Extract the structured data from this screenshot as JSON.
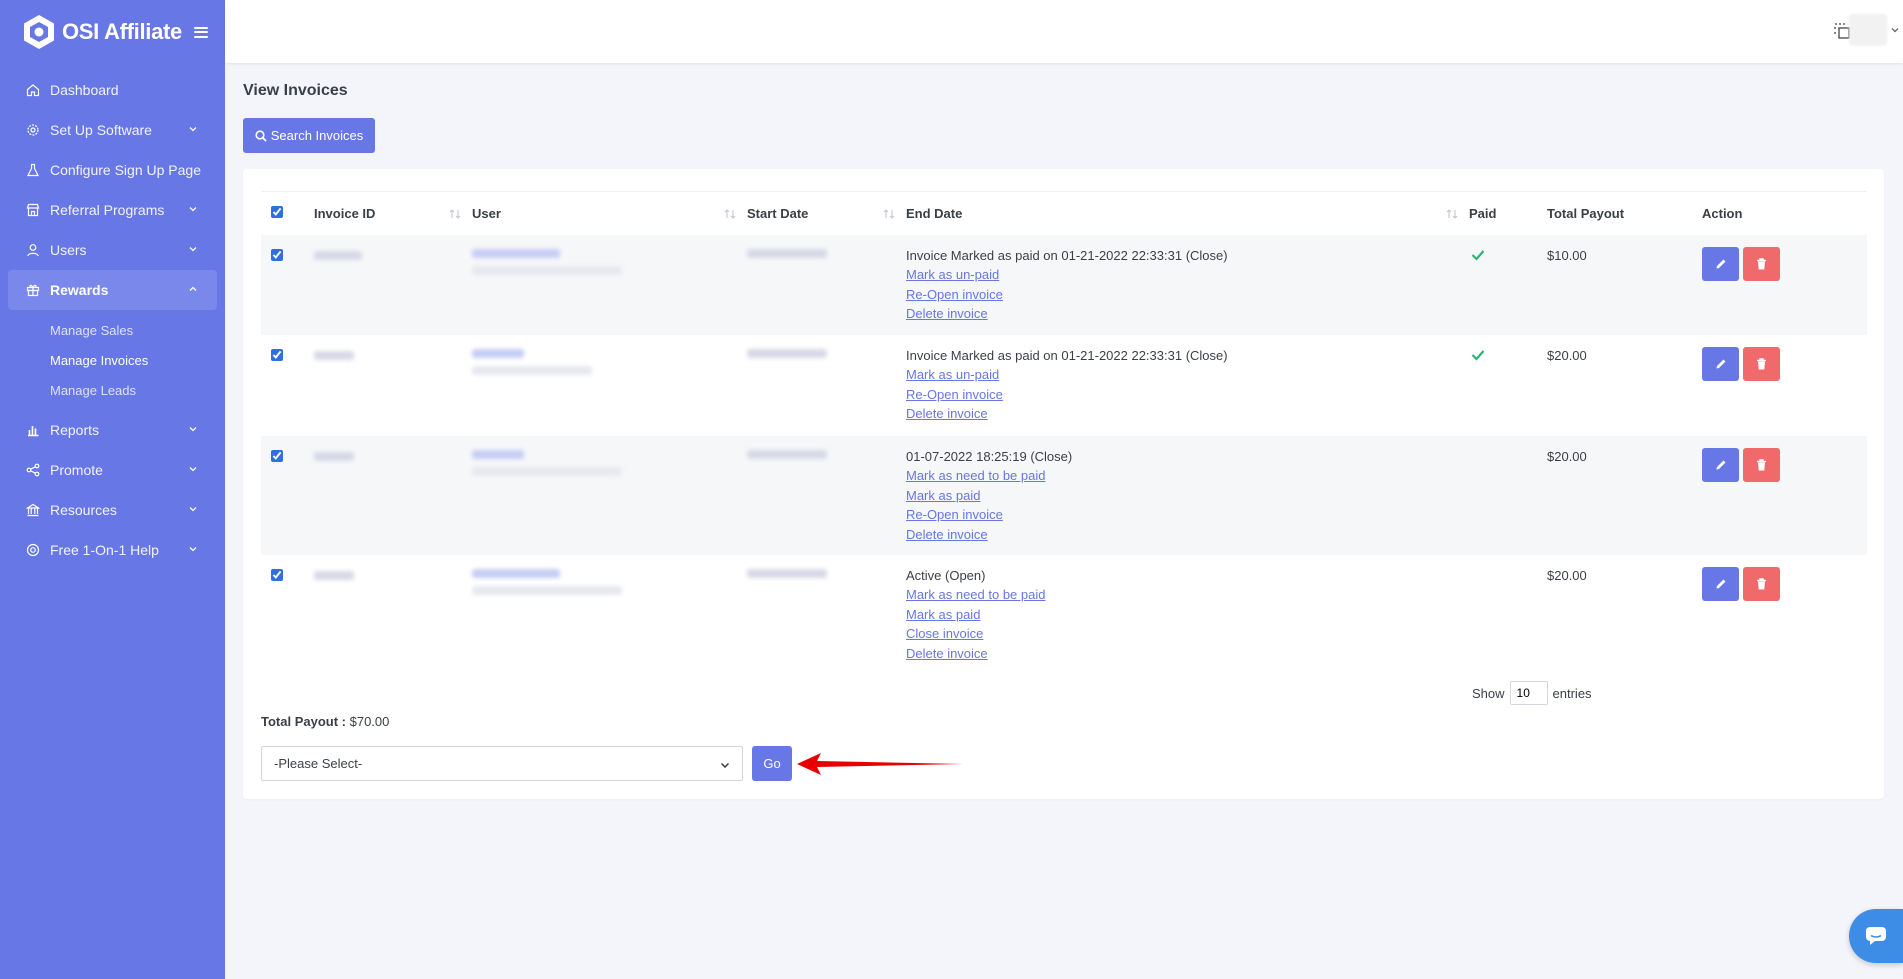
{
  "app": {
    "name": "OSI Affiliate"
  },
  "sidebar": {
    "items": [
      {
        "label": "Dashboard"
      },
      {
        "label": "Set Up Software"
      },
      {
        "label": "Configure Sign Up Page"
      },
      {
        "label": "Referral Programs"
      },
      {
        "label": "Users"
      },
      {
        "label": "Rewards"
      },
      {
        "label": "Reports"
      },
      {
        "label": "Promote"
      },
      {
        "label": "Resources"
      },
      {
        "label": "Free 1-On-1 Help"
      }
    ],
    "rewards_sub": [
      {
        "label": "Manage Sales"
      },
      {
        "label": "Manage Invoices"
      },
      {
        "label": "Manage Leads"
      }
    ]
  },
  "page": {
    "title": "View Invoices",
    "search_button": "Search Invoices"
  },
  "table": {
    "headers": {
      "invoice_id": "Invoice ID",
      "user": "User",
      "start_date": "Start Date",
      "end_date": "End Date",
      "paid": "Paid",
      "total_payout": "Total Payout",
      "action": "Action"
    },
    "rows": [
      {
        "end_status": "Invoice Marked as paid on 01-21-2022 22:33:31 (Close)",
        "links": [
          "Mark as un-paid",
          "Re-Open invoice",
          "Delete invoice"
        ],
        "paid": true,
        "total": "$10.00"
      },
      {
        "end_status": "Invoice Marked as paid on 01-21-2022 22:33:31 (Close)",
        "links": [
          "Mark as un-paid",
          "Re-Open invoice",
          "Delete invoice"
        ],
        "paid": true,
        "total": "$20.00"
      },
      {
        "end_status": "01-07-2022 18:25:19 (Close)",
        "links": [
          "Mark as need to be paid",
          "Mark as paid",
          "Re-Open invoice",
          "Delete invoice"
        ],
        "paid": false,
        "total": "$20.00"
      },
      {
        "end_status": "Active (Open)",
        "links": [
          "Mark as need to be paid",
          "Mark as paid",
          "Close invoice",
          "Delete invoice"
        ],
        "paid": false,
        "total": "$20.00"
      }
    ]
  },
  "entries": {
    "show": "Show",
    "value": "10",
    "suffix": "entries"
  },
  "footer": {
    "total_label": "Total Payout :",
    "total_value": "$70.00",
    "select_value": "-Please Select-",
    "go_button": "Go"
  },
  "colors": {
    "primary": "#6777e6",
    "danger": "#f0696b",
    "success": "#2bb673",
    "link": "#6776e2",
    "arrow": "#e60000"
  }
}
